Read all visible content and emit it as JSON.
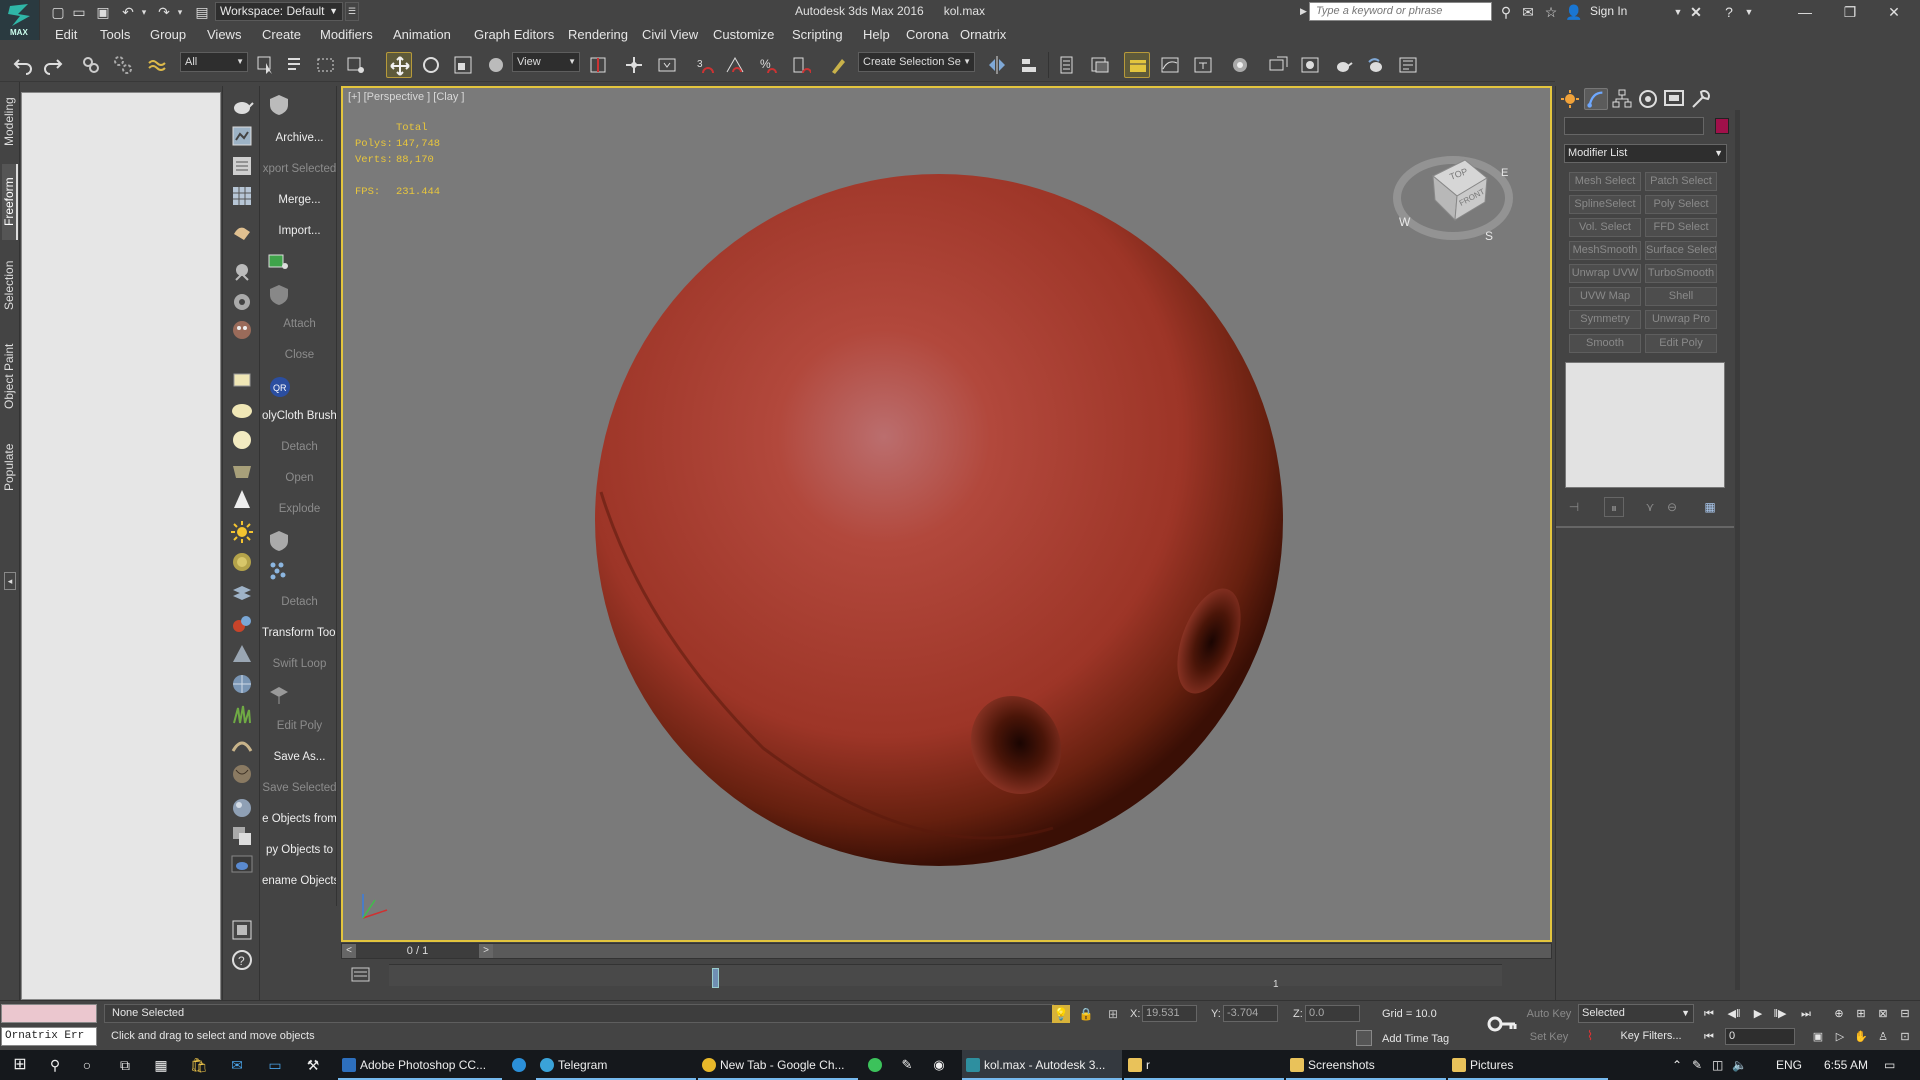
{
  "titlebar": {
    "workspace": "Workspace: Default",
    "window_title": "Autodesk 3ds Max 2016      kol.max",
    "search_placeholder": "Type a keyword or phrase",
    "sign_in": "Sign In",
    "app_logo_text": "MAX"
  },
  "menu": [
    "Edit",
    "Tools",
    "Group",
    "Views",
    "Create",
    "Modifiers",
    "Animation",
    "Graph Editors",
    "Rendering",
    "Civil View",
    "Customize",
    "Scripting",
    "Help",
    "Corona",
    "Ornatrix"
  ],
  "toolbar": {
    "selection_filter": "All",
    "reference_coord": "View",
    "named_selection": "Create Selection Se"
  },
  "ribbon_tabs": [
    "Modeling",
    "Freeform",
    "Selection",
    "Object Paint",
    "Populate"
  ],
  "commands": [
    {
      "label": "Archive...",
      "enabled": true
    },
    {
      "label": "xport Selected",
      "enabled": false
    },
    {
      "label": "Merge...",
      "enabled": true
    },
    {
      "label": "Import...",
      "enabled": true
    },
    {
      "label": "Attach",
      "enabled": false
    },
    {
      "label": "Close",
      "enabled": false
    },
    {
      "label": "olyCloth Brushe",
      "enabled": true
    },
    {
      "label": "Detach",
      "enabled": false
    },
    {
      "label": "Open",
      "enabled": false
    },
    {
      "label": "Explode",
      "enabled": false
    },
    {
      "label": "Detach",
      "enabled": false
    },
    {
      "label": "Transform Tool",
      "enabled": true
    },
    {
      "label": "Swift Loop",
      "enabled": false
    },
    {
      "label": "Edit Poly",
      "enabled": false
    },
    {
      "label": "Save As...",
      "enabled": true
    },
    {
      "label": "Save Selected",
      "enabled": false
    },
    {
      "label": "e Objects from",
      "enabled": true
    },
    {
      "label": "py Objects to",
      "enabled": true
    },
    {
      "label": "ename Objects",
      "enabled": true
    }
  ],
  "viewport": {
    "label": "[+] [Perspective ] [Clay ]",
    "stats": {
      "header": "Total",
      "polys_label": "Polys:",
      "polys": "147,748",
      "verts_label": "Verts:",
      "verts": "88,170",
      "fps_label": "FPS:",
      "fps": "231.444"
    },
    "viewcube": {
      "top": "TOP",
      "front": "FRONT",
      "west": "W",
      "south": "S",
      "east": "E"
    },
    "object_color": "#c44a3a"
  },
  "timeline": {
    "frame_display": "0 / 1",
    "tick_label": "1"
  },
  "command_panel": {
    "modifier_list": "Modifier List",
    "object_color": "#a0104a",
    "modifier_buttons": [
      "Mesh Select",
      "Patch Select",
      "SplineSelect",
      "Poly Select",
      "Vol. Select",
      "FFD Select",
      "MeshSmooth",
      "Surface Select",
      "Unwrap UVW",
      "TurboSmooth",
      "UVW Map",
      "Shell",
      "Symmetry",
      "Unwrap Pro",
      "Smooth",
      "Edit Poly"
    ]
  },
  "status": {
    "maxscript": "Ornatrix Err",
    "selection": "None Selected",
    "prompt": "Click and drag to select and move objects",
    "x_label": "X:",
    "x": "19.531",
    "y_label": "Y:",
    "y": "-3.704",
    "z_label": "Z:",
    "z": "0.0",
    "grid": "Grid = 10.0",
    "add_time_tag": "Add Time Tag",
    "auto_key": "Auto Key",
    "set_key": "Set Key",
    "selected_dd": "Selected",
    "key_filters": "Key Filters...",
    "current_frame": "0"
  },
  "taskbar": {
    "apps": [
      {
        "label": "Adobe Photoshop CC...",
        "color": "#2d6fbd"
      },
      {
        "label": "Telegram",
        "color": "#3aa3d9"
      },
      {
        "label": "New Tab - Google Ch...",
        "color": "#e8b82a"
      },
      {
        "label": "kol.max - Autodesk 3...",
        "color": "#2e8f9f"
      },
      {
        "label": "r",
        "color": "#e9c25a"
      },
      {
        "label": "Screenshots",
        "color": "#e9c25a"
      },
      {
        "label": "Pictures",
        "color": "#e9c25a"
      }
    ],
    "lang": "ENG",
    "time": "6:55 AM"
  }
}
